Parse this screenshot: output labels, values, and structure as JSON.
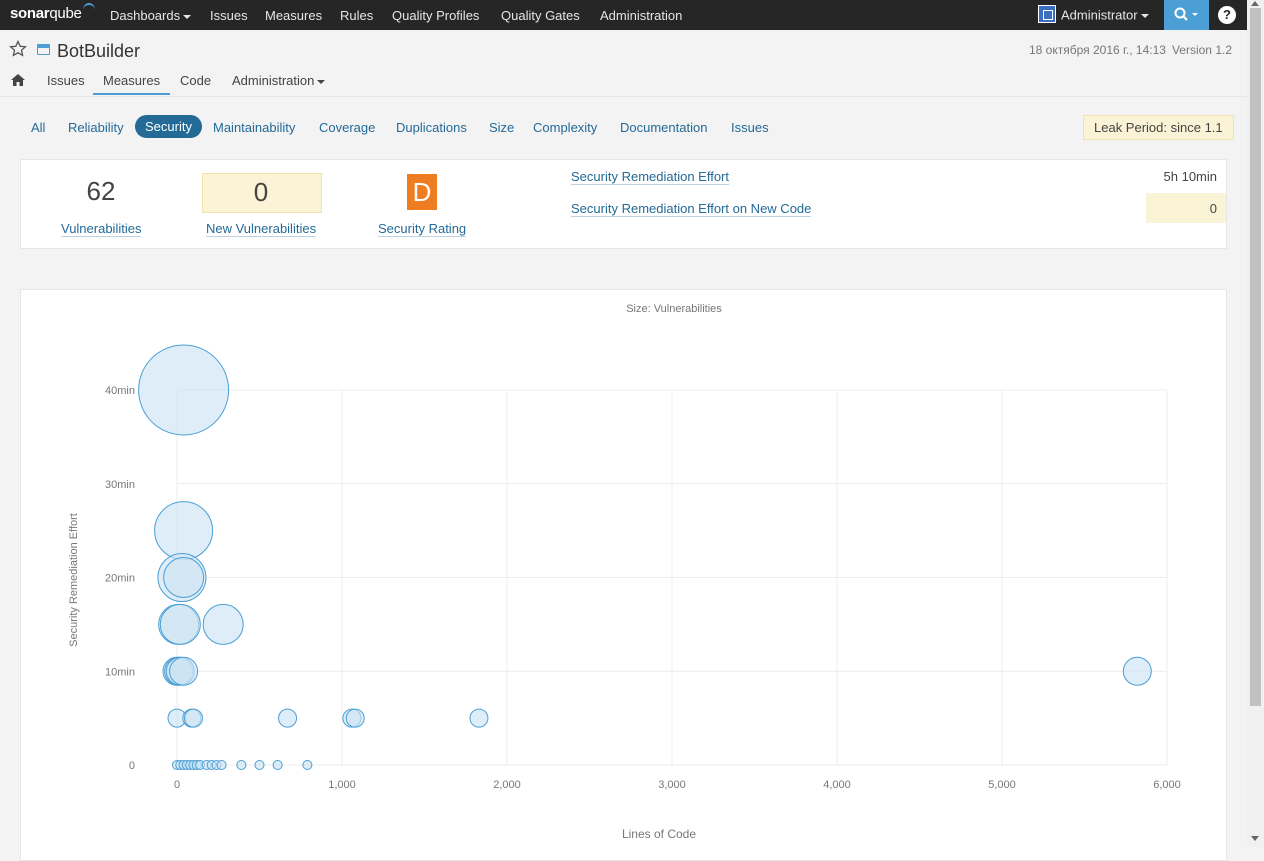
{
  "topnav": {
    "logo_sonar": "sonar",
    "logo_qube": "qube",
    "items": [
      "Dashboards",
      "Issues",
      "Measures",
      "Rules",
      "Quality Profiles",
      "Quality Gates",
      "Administration"
    ],
    "user": "Administrator",
    "help": "?",
    "icons": {
      "search": "search-icon",
      "help": "help-icon",
      "avatar": "avatar"
    }
  },
  "component": {
    "name": "BotBuilder",
    "date": "18 октября 2016 г., 14:13",
    "version": "Version 1.2",
    "tabs": [
      "Issues",
      "Measures",
      "Code",
      "Administration"
    ],
    "active_tab": "Measures"
  },
  "domains": {
    "tabs": [
      "All",
      "Reliability",
      "Security",
      "Maintainability",
      "Coverage",
      "Duplications",
      "Size",
      "Complexity",
      "Documentation",
      "Issues"
    ],
    "active": "Security",
    "leak_period": "Leak Period: since 1.1"
  },
  "summary": {
    "vulnerabilities_value": "62",
    "vulnerabilities_label": "Vulnerabilities",
    "new_vulnerabilities_value": "0",
    "new_vulnerabilities_label": "New Vulnerabilities",
    "security_rating_value": "D",
    "security_rating_label": "Security Rating",
    "remediation_effort_label": "Security Remediation Effort",
    "remediation_effort_value": "5h 10min",
    "remediation_new_label": "Security Remediation Effort on New Code",
    "remediation_new_value": "0"
  },
  "colors": {
    "accent": "#236a97",
    "nav_bg": "#262626",
    "search_bg": "#4b9fd5",
    "rating_d": "#ed7d20",
    "leak_bg": "#fbf3d5",
    "bubble_fill": "#cde3f3",
    "bubble_stroke": "#4b9fd5"
  },
  "chart_data": {
    "type": "scatter",
    "title": "Size: Vulnerabilities",
    "xlabel": "Lines of Code",
    "ylabel": "Security Remediation Effort",
    "x_ticks": [
      "0",
      "1,000",
      "2,000",
      "3,000",
      "4,000",
      "5,000",
      "6,000"
    ],
    "y_ticks": [
      "0",
      "10min",
      "20min",
      "30min",
      "40min"
    ],
    "xlim": [
      0,
      6000
    ],
    "ylim": [
      0,
      40
    ],
    "grid": true,
    "points": [
      {
        "x": 40,
        "y": 40,
        "size": 8
      },
      {
        "x": 40,
        "y": 25,
        "size": 5
      },
      {
        "x": 30,
        "y": 20,
        "size": 4
      },
      {
        "x": 40,
        "y": 20,
        "size": 3
      },
      {
        "x": 10,
        "y": 15,
        "size": 3
      },
      {
        "x": 20,
        "y": 15,
        "size": 3
      },
      {
        "x": 280,
        "y": 15,
        "size": 3
      },
      {
        "x": 0,
        "y": 10,
        "size": 2
      },
      {
        "x": 10,
        "y": 10,
        "size": 2
      },
      {
        "x": 20,
        "y": 10,
        "size": 2
      },
      {
        "x": 40,
        "y": 10,
        "size": 2
      },
      {
        "x": 5820,
        "y": 10,
        "size": 2
      },
      {
        "x": 0,
        "y": 5,
        "size": 1
      },
      {
        "x": 90,
        "y": 5,
        "size": 1
      },
      {
        "x": 100,
        "y": 5,
        "size": 1
      },
      {
        "x": 670,
        "y": 5,
        "size": 1
      },
      {
        "x": 1060,
        "y": 5,
        "size": 1
      },
      {
        "x": 1080,
        "y": 5,
        "size": 1
      },
      {
        "x": 1830,
        "y": 5,
        "size": 1
      },
      {
        "x": 0,
        "y": 0,
        "size": 0
      },
      {
        "x": 20,
        "y": 0,
        "size": 0
      },
      {
        "x": 40,
        "y": 0,
        "size": 0
      },
      {
        "x": 60,
        "y": 0,
        "size": 0
      },
      {
        "x": 80,
        "y": 0,
        "size": 0
      },
      {
        "x": 100,
        "y": 0,
        "size": 0
      },
      {
        "x": 120,
        "y": 0,
        "size": 0
      },
      {
        "x": 140,
        "y": 0,
        "size": 0
      },
      {
        "x": 180,
        "y": 0,
        "size": 0
      },
      {
        "x": 210,
        "y": 0,
        "size": 0
      },
      {
        "x": 240,
        "y": 0,
        "size": 0
      },
      {
        "x": 270,
        "y": 0,
        "size": 0
      },
      {
        "x": 390,
        "y": 0,
        "size": 0
      },
      {
        "x": 500,
        "y": 0,
        "size": 0
      },
      {
        "x": 610,
        "y": 0,
        "size": 0
      },
      {
        "x": 790,
        "y": 0,
        "size": 0
      }
    ]
  }
}
